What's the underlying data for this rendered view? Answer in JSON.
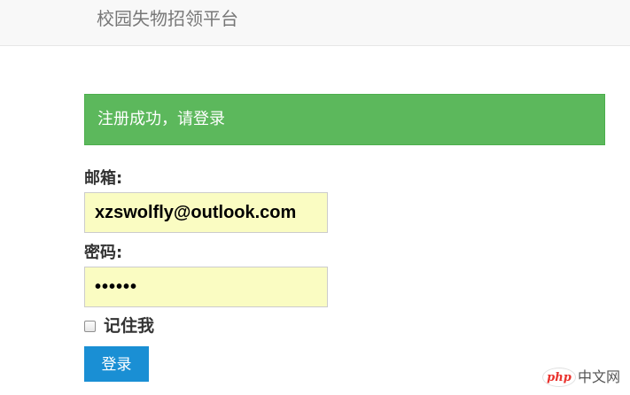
{
  "app": {
    "brand": "校园失物招领平台"
  },
  "alert": {
    "message": "注册成功，请登录"
  },
  "form": {
    "email_label": "邮箱:",
    "email_value": "xzswolfly@outlook.com",
    "password_label": "密码:",
    "password_value": "••••••",
    "remember_label": "记住我",
    "remember_checked": false,
    "submit_label": "登录"
  },
  "watermark": {
    "logo_text": "php",
    "site_text": "中文网"
  },
  "colors": {
    "alert_bg": "#5cb85c",
    "input_autofill_bg": "#fafcc2",
    "button_bg": "#1a8fd4",
    "navbar_bg": "#f8f8f8"
  }
}
